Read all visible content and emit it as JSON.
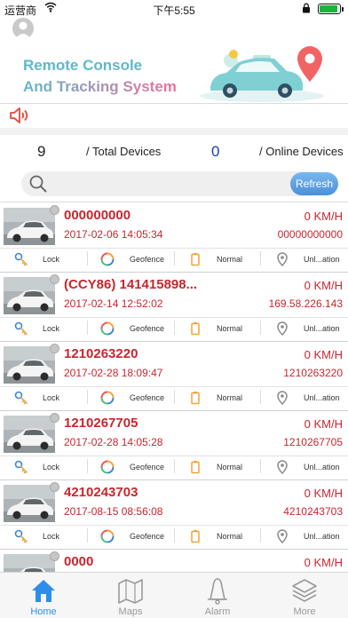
{
  "status_bar": {
    "carrier": "运营商",
    "time": "下午5:55",
    "battery_level": 0.9
  },
  "banner": {
    "line1": "Remote Console",
    "line2": "And Tracking System"
  },
  "counts": {
    "total": "9",
    "total_label": "/ Total Devices",
    "online": "0",
    "online_label": "/ Online Devices"
  },
  "search": {
    "value": "",
    "placeholder": "",
    "refresh_label": "Refresh"
  },
  "devices": [
    {
      "name": "000000000",
      "speed": "0 KM/H",
      "time": "2017-02-06 14:05:34",
      "imei": "00000000000",
      "lock": "Lock",
      "geofence": "Geofence",
      "power": "Normal",
      "location": "Unl...ation"
    },
    {
      "name": "(CCY86) 141415898...",
      "speed": "0 KM/H",
      "time": "2017-02-14 12:52:02",
      "imei": "169.58.226.143",
      "lock": "Lock",
      "geofence": "Geofence",
      "power": "Normal",
      "location": "Unl...ation"
    },
    {
      "name": "1210263220",
      "speed": "0 KM/H",
      "time": "2017-02-28 18:09:47",
      "imei": "1210263220",
      "lock": "Lock",
      "geofence": "Geofence",
      "power": "Normal",
      "location": "Unl...ation"
    },
    {
      "name": "1210267705",
      "speed": "0 KM/H",
      "time": "2017-02-28 14:05:28",
      "imei": "1210267705",
      "lock": "Lock",
      "geofence": "Geofence",
      "power": "Normal",
      "location": "Unl...ation"
    },
    {
      "name": "4210243703",
      "speed": "0 KM/H",
      "time": "2017-08-15 08:56:08",
      "imei": "4210243703",
      "lock": "Lock",
      "geofence": "Geofence",
      "power": "Normal",
      "location": "Unl...ation"
    },
    {
      "name": "0000",
      "speed": "0 KM/H",
      "time": "",
      "imei": "",
      "lock": "",
      "geofence": "",
      "power": "",
      "location": ""
    }
  ],
  "tabs": [
    {
      "label": "Home",
      "icon": "home-icon",
      "active": true
    },
    {
      "label": "Maps",
      "icon": "map-icon",
      "active": false
    },
    {
      "label": "Alarm",
      "icon": "bell-icon",
      "active": false
    },
    {
      "label": "More",
      "icon": "layers-icon",
      "active": false
    }
  ],
  "colors": {
    "accent": "#2c8ee8",
    "alert_red": "#c9252e",
    "online_blue": "#1a3fb0"
  }
}
